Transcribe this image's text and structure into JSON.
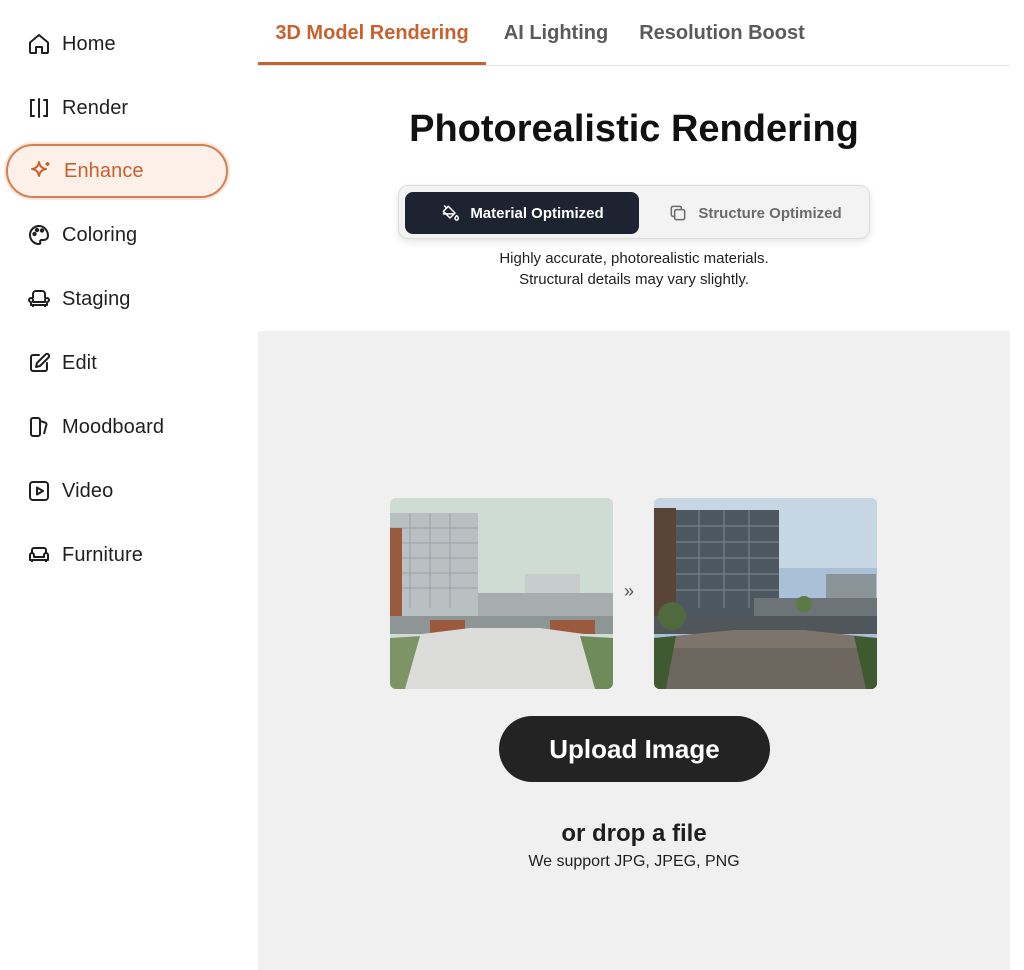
{
  "sidebar": {
    "items": [
      {
        "label": "Home",
        "icon": "home-icon"
      },
      {
        "label": "Render",
        "icon": "render-icon"
      },
      {
        "label": "Enhance",
        "icon": "sparkle-icon",
        "active": true
      },
      {
        "label": "Coloring",
        "icon": "palette-icon"
      },
      {
        "label": "Staging",
        "icon": "armchair-icon"
      },
      {
        "label": "Edit",
        "icon": "edit-icon"
      },
      {
        "label": "Moodboard",
        "icon": "moodboard-icon"
      },
      {
        "label": "Video",
        "icon": "play-icon"
      },
      {
        "label": "Furniture",
        "icon": "sofa-icon"
      }
    ]
  },
  "tabs": [
    {
      "label": "3D Model Rendering",
      "active": true
    },
    {
      "label": "AI Lighting"
    },
    {
      "label": "Resolution Boost"
    }
  ],
  "main": {
    "title": "Photorealistic Rendering",
    "modes": [
      {
        "label": "Material Optimized",
        "icon": "paint-bucket-icon",
        "selected": true
      },
      {
        "label": "Structure Optimized",
        "icon": "copy-icon"
      }
    ],
    "description_line1": "Highly accurate, photorealistic materials.",
    "description_line2": "Structural details may vary slightly.",
    "preview_arrow": "»",
    "upload_label": "Upload Image",
    "drop_label": "or drop a file",
    "support_label": "We support JPG, JPEG, PNG"
  },
  "colors": {
    "accent": "#c8612d",
    "dark_button": "#232323",
    "toggle_selected": "#1d2330",
    "drop_area_bg": "#f0f0f0"
  }
}
